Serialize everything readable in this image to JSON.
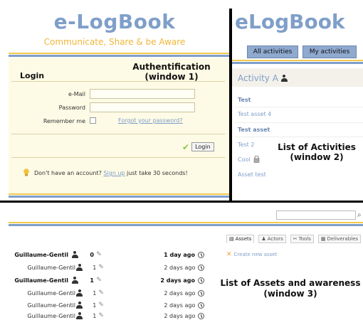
{
  "window1": {
    "title": "e-LogBook",
    "tagline": "Communicate, Share & be Aware",
    "heading": "Login",
    "annotation_line1": "Authentification",
    "annotation_line2": "(window 1)",
    "email_label": "e-Mail",
    "email_value": "",
    "password_label": "Password",
    "password_value": "",
    "remember_label": "Remember me",
    "forgot_link": "Forgot your password?",
    "login_button": "Login",
    "signup_prefix": "Don't have an account?",
    "signup_link": "Sign up",
    "signup_suffix": "just take 30 seconds!"
  },
  "window2": {
    "title": "eLogBook",
    "tabs": [
      {
        "label": "All activities"
      },
      {
        "label": "My activities"
      }
    ],
    "activity_title": "Activity A",
    "items": [
      {
        "label": "Test",
        "bold": true
      },
      {
        "label": "Test asset 4",
        "bold": false
      },
      {
        "label": "Test asset",
        "bold": true
      },
      {
        "label": "Test 2",
        "bold": false
      },
      {
        "label": "Cool",
        "bold": false
      },
      {
        "label": "Asset test",
        "bold": false
      }
    ],
    "annotation_line1": "List of Activities",
    "annotation_line2": "(window 2)"
  },
  "window3": {
    "search_value": "",
    "tabs": [
      {
        "label": "Assets",
        "icon": "page-icon"
      },
      {
        "label": "Actors",
        "icon": "people-icon"
      },
      {
        "label": "Tools",
        "icon": "tools-icon"
      },
      {
        "label": "Deliverables",
        "icon": "document-icon"
      }
    ],
    "create_asset": "Create new asset",
    "annotation_line1": "List of Assets and awareness",
    "annotation_line2": "(window 3)",
    "rows": [
      {
        "user": "Guillaume-Gentil",
        "count": "0",
        "date": "1 day ago",
        "bold": true
      },
      {
        "user": "Guillaume-Gentil",
        "count": "1",
        "date": "2 days ago",
        "bold": false
      },
      {
        "user": "Guillaume-Gentil",
        "count": "1",
        "date": "2 days ago",
        "bold": true
      },
      {
        "user": "Guillaume-Gentil",
        "count": "1",
        "date": "2 days ago",
        "bold": false
      },
      {
        "user": "Guillaume-Gentil",
        "count": "1",
        "date": "2 days ago",
        "bold": false
      },
      {
        "user": "Guillaume-Gentil",
        "count": "1",
        "date": "2 days ago",
        "bold": false
      }
    ]
  },
  "colors": {
    "brand_blue": "#7f9fc9",
    "brand_orange": "#f0b63a",
    "panel_yellow": "#fdfbe6",
    "tab_blue": "#8fa9cf"
  }
}
